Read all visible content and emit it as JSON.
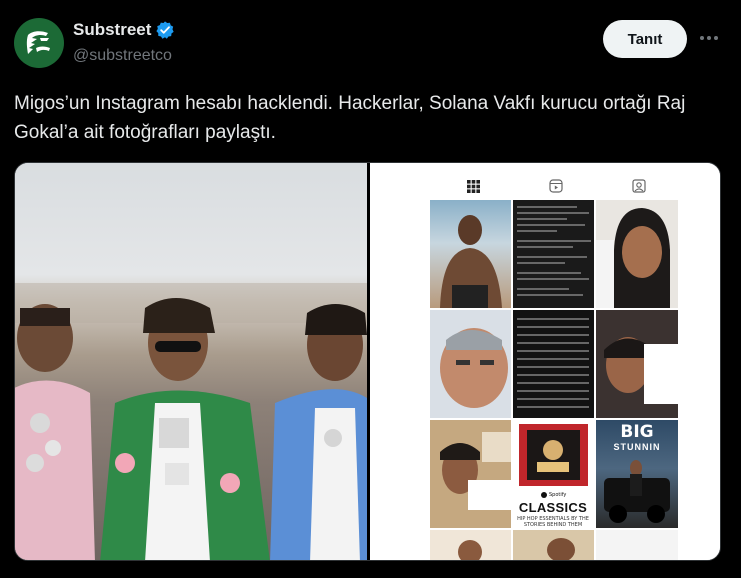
{
  "account": {
    "display_name": "Substreet",
    "handle": "@substreetco",
    "verified": true
  },
  "actions": {
    "follow_label": "Tanıt"
  },
  "tweet": {
    "text": "Migos’un Instagram hesabı hacklendi. Hackerlar, Solana Vakfı kurucu ortağı Raj Gokal’a ait fotoğrafları paylaştı."
  },
  "media": {
    "album_title": "CLASSICS",
    "album_brand": "Spotify",
    "album_subtitle": "HIP HOP ESSENTIALS BY THE STORIES BEHIND THEM",
    "poster_title": "BIG",
    "poster_subtitle": "STUNNIN"
  },
  "colors": {
    "background": "#000000",
    "text_primary": "#e7e9ea",
    "text_secondary": "#71767b",
    "verified_blue": "#1d9bf0",
    "follow_bg": "#eff3f4",
    "avatar_bg": "#1c6a36"
  },
  "icons": [
    "verified-badge-icon",
    "more-options-icon",
    "grid-tab-icon",
    "reels-tab-icon",
    "tagged-tab-icon"
  ]
}
